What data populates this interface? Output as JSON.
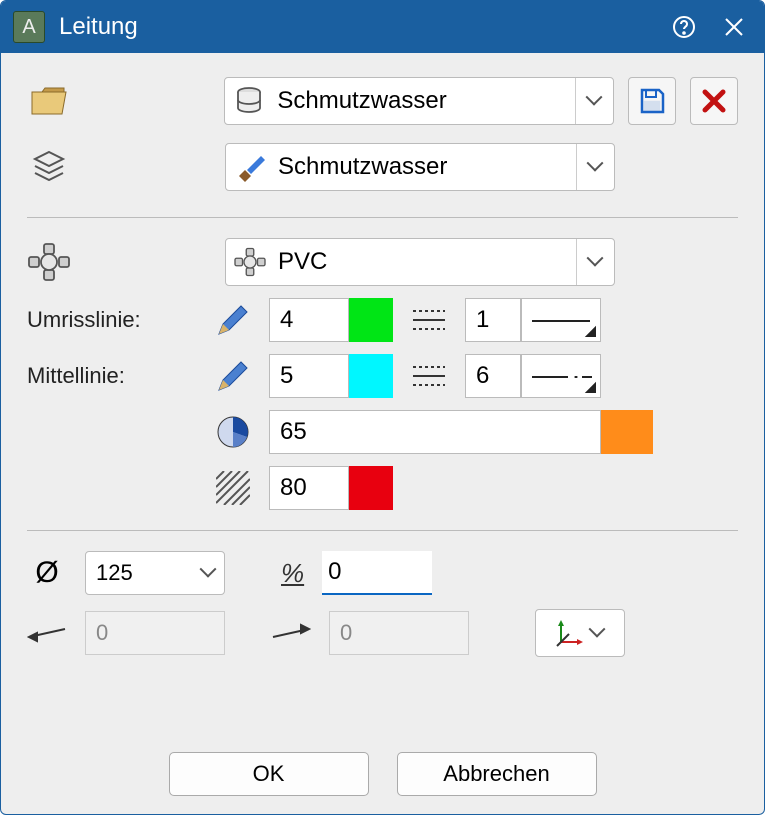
{
  "title": "Leitung",
  "profile": {
    "value": "Schmutzwasser"
  },
  "layer": {
    "value": "Schmutzwasser"
  },
  "material": {
    "value": "PVC"
  },
  "labels": {
    "outline": "Umrisslinie:",
    "center": "Mittellinie:"
  },
  "outline": {
    "pen": "4",
    "lineType": "1"
  },
  "center": {
    "pen": "5",
    "lineType": "6"
  },
  "fill": {
    "value": "65"
  },
  "hatch": {
    "value": "80"
  },
  "diameter": {
    "value": "125"
  },
  "gradient": {
    "label": "%",
    "value": "0"
  },
  "heightStart": {
    "value": "0"
  },
  "heightEnd": {
    "value": "0"
  },
  "buttons": {
    "ok": "OK",
    "cancel": "Abbrechen"
  },
  "appIconLetter": "A"
}
